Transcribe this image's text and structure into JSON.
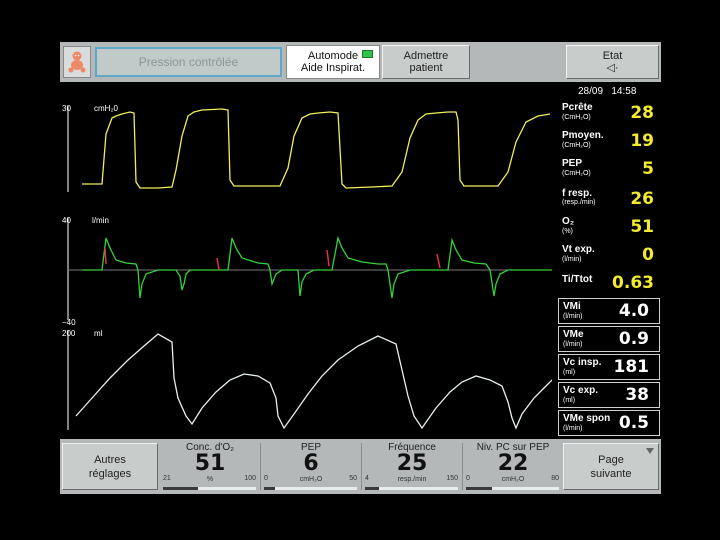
{
  "top": {
    "mode_label": "Pression contrôlée",
    "auto_line1": "Automode",
    "auto_line2": "Aide Inspirat.",
    "admit_line1": "Admettre",
    "admit_line2": "patient",
    "etat_line1": "Etat",
    "etat_line2": "◁·"
  },
  "datetime": {
    "date": "28/09",
    "time": "14:58"
  },
  "waveforms": {
    "pressure": {
      "max": "30",
      "unit": "cmH₂0"
    },
    "flow": {
      "max": "40",
      "unit": "l/min",
      "min": "−40"
    },
    "volume": {
      "max": "200",
      "unit": "ml"
    }
  },
  "params": [
    {
      "label": "Pcrête",
      "unit": "(CmH₂O)",
      "value": "28"
    },
    {
      "label": "Pmoyen.",
      "unit": "(CmH₂O)",
      "value": "19"
    },
    {
      "label": "PEP",
      "unit": "(CmH₂O)",
      "value": "5"
    },
    {
      "label": "f resp.",
      "unit": "(resp./min)",
      "value": "26"
    },
    {
      "label": "O₂",
      "unit": "(%)",
      "value": "51"
    },
    {
      "label": "Vt exp.",
      "unit": "(l/min)",
      "value": "0"
    },
    {
      "label": "Ti/Ttot",
      "unit": "",
      "value": "0.63"
    }
  ],
  "boxed_params": [
    {
      "label": "VMi",
      "unit": "(l/min)",
      "value": "4.0"
    },
    {
      "label": "VMe",
      "unit": "(l/min)",
      "value": "0.9"
    },
    {
      "label": "Vc insp.",
      "unit": "(ml)",
      "value": "181"
    },
    {
      "label": "Vc exp.",
      "unit": "(ml)",
      "value": "38"
    },
    {
      "label": "VMe spon",
      "unit": "(l/min)",
      "value": "0.5"
    }
  ],
  "bottom": {
    "autres_line1": "Autres",
    "autres_line2": "réglages",
    "page_line1": "Page",
    "page_line2": "suivante",
    "controls": [
      {
        "title": "Conc. d'O₂",
        "value": "51",
        "min": "21",
        "unit": "%",
        "max": "100",
        "fraction": 0.38
      },
      {
        "title": "PEP",
        "value": "6",
        "min": "0",
        "unit": "cmH₂O",
        "max": "50",
        "fraction": 0.12
      },
      {
        "title": "Fréquence",
        "value": "25",
        "min": "4",
        "unit": "resp./min",
        "max": "150",
        "fraction": 0.15
      },
      {
        "title": "Niv. PC sur PEP",
        "value": "22",
        "min": "0",
        "unit": "cmH₂O",
        "max": "80",
        "fraction": 0.28
      }
    ]
  },
  "colors": {
    "pressure_trace": "#f2ee5a",
    "flow_trace": "#35d13a",
    "volume_trace": "#e8f0ee",
    "flow_marker": "#e0304a",
    "value_yellow": "#f4ea2e"
  }
}
